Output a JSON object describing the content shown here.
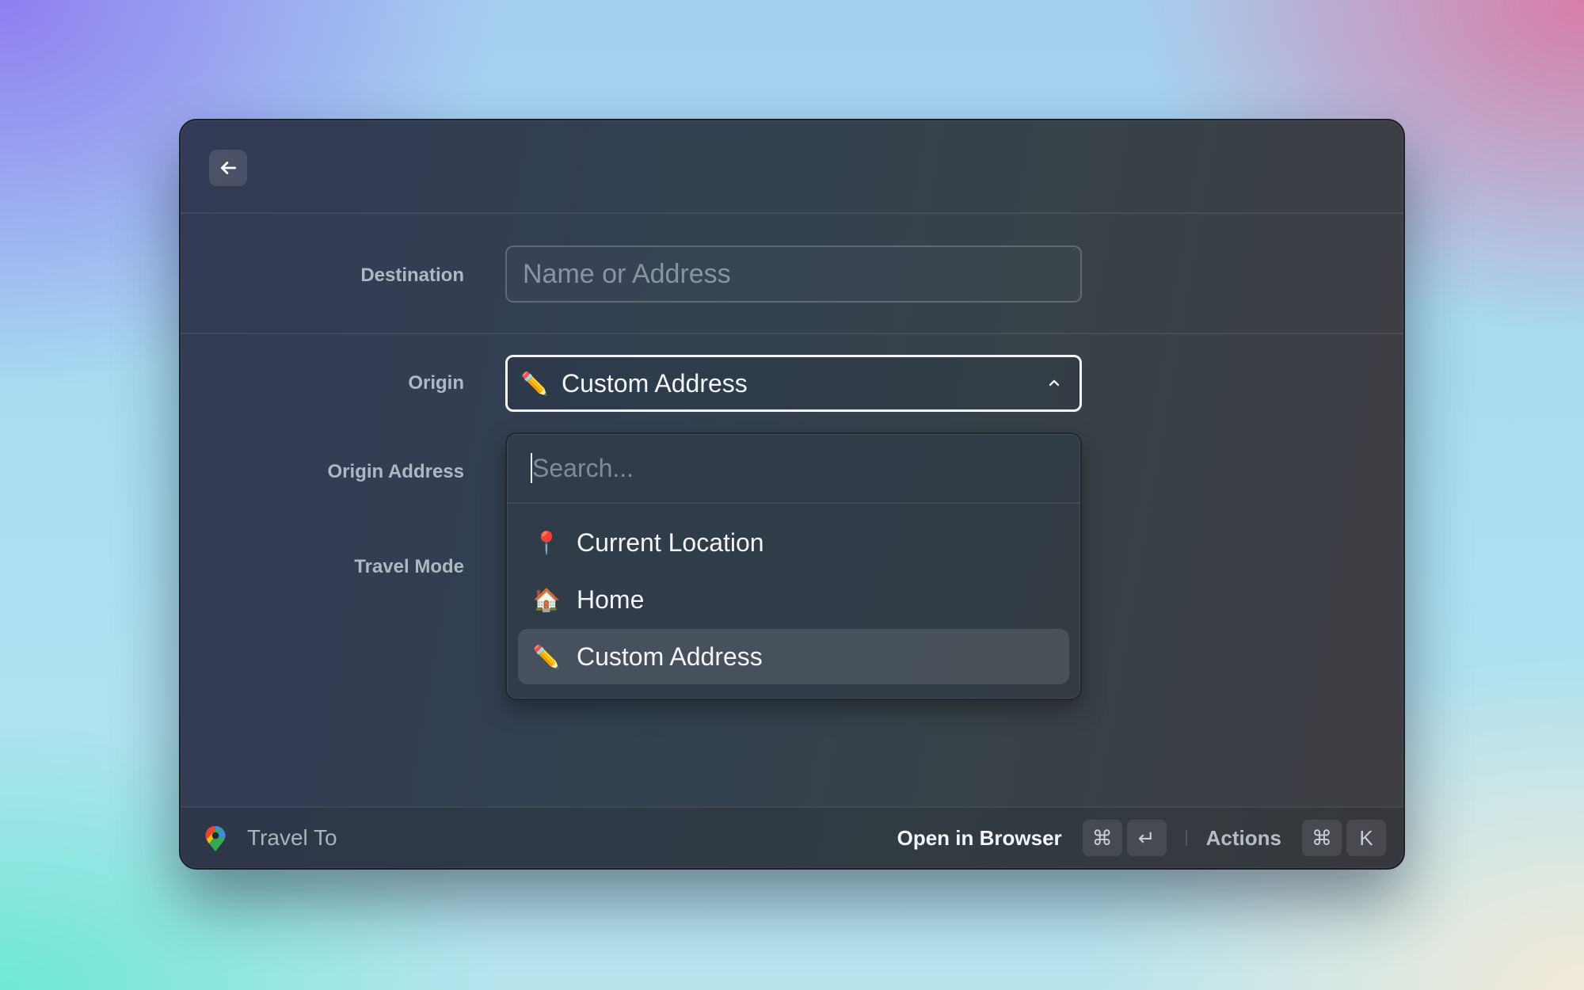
{
  "window": {
    "back_button": {
      "icon": "arrow-left-icon"
    }
  },
  "form": {
    "destination": {
      "label": "Destination",
      "value": "",
      "placeholder": "Name or Address"
    },
    "origin": {
      "label": "Origin",
      "selected_icon": "✏️",
      "selected_value": "Custom Address",
      "chevron": "chevron-up-icon",
      "expanded": true
    },
    "origin_address": {
      "label": "Origin Address"
    },
    "travel_mode": {
      "label": "Travel Mode"
    }
  },
  "dropdown": {
    "search_placeholder": "Search...",
    "search_value": "",
    "options": [
      {
        "icon": "📍",
        "icon_name": "round-pushpin-icon",
        "label": "Current Location",
        "selected": false
      },
      {
        "icon": "🏠",
        "icon_name": "house-icon",
        "label": "Home",
        "selected": false
      },
      {
        "icon": "✏️",
        "icon_name": "pencil-icon",
        "label": "Custom Address",
        "selected": true
      }
    ]
  },
  "footer": {
    "app_icon": "google-maps-pin-icon",
    "app_title": "Travel To",
    "primary_action": {
      "label": "Open in Browser",
      "shortcut": [
        "⌘",
        "↵"
      ]
    },
    "actions": {
      "label": "Actions",
      "shortcut": [
        "⌘",
        "K"
      ]
    }
  }
}
